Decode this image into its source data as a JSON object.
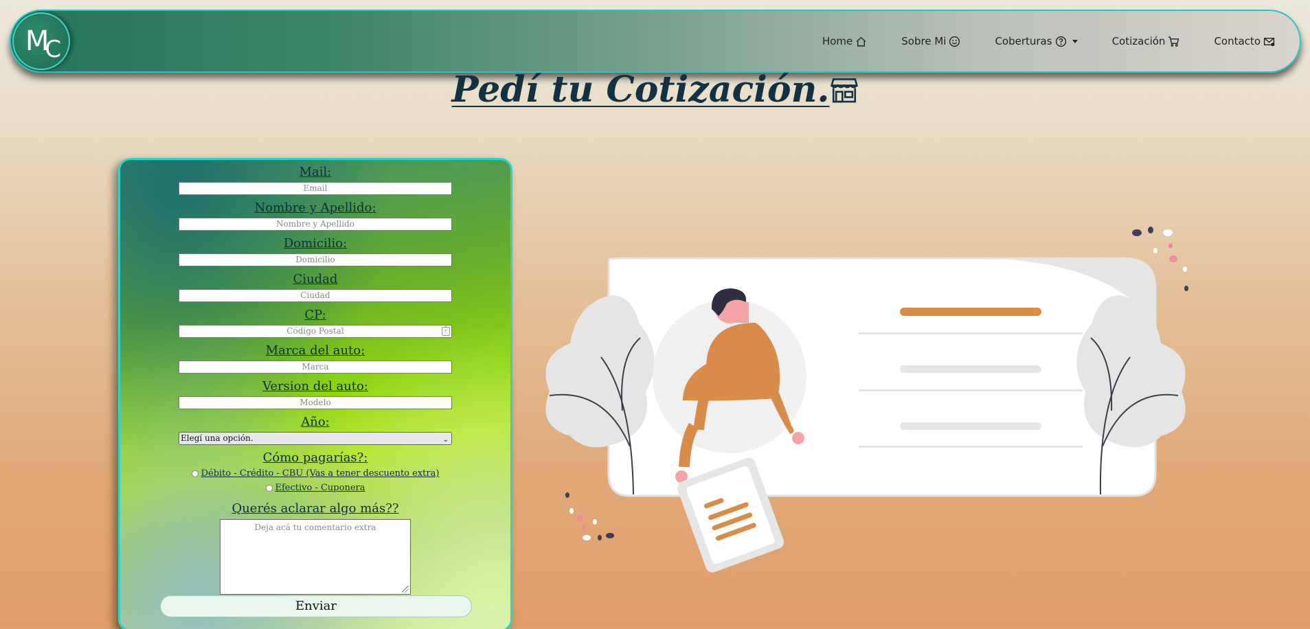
{
  "nav": {
    "logo_text": "MC",
    "items": [
      {
        "label": "Home",
        "icon": "home-icon"
      },
      {
        "label": "Sobre Mi",
        "icon": "smile-icon"
      },
      {
        "label": "Coberturas",
        "icon": "question-circle-icon"
      },
      {
        "label": "Cotización",
        "icon": "cart-icon"
      },
      {
        "label": "Contacto",
        "icon": "envelope-icon"
      }
    ]
  },
  "page": {
    "title": "Pedí tu Cotización.",
    "title_icon": "shop-icon"
  },
  "form": {
    "mail": {
      "label": "Mail:",
      "placeholder": "Email"
    },
    "nombre": {
      "label": "Nombre y Apellido:",
      "placeholder": "Nombre y Apellido"
    },
    "domicilio": {
      "label": "Domicilio:",
      "placeholder": "Domicilio"
    },
    "ciudad": {
      "label": "Ciudad",
      "placeholder": "Ciudad"
    },
    "cp": {
      "label": "CP:",
      "placeholder": "Código Postal"
    },
    "marca": {
      "label": "Marca del auto:",
      "placeholder": "Marca"
    },
    "version": {
      "label": "Version del auto:",
      "placeholder": "Modelo"
    },
    "anio": {
      "label": "Año:",
      "selected": "Elegí una opción."
    },
    "pago": {
      "label": "Cómo pagarías?:",
      "options": [
        "Débito - Crédito - CBU (Vas a tener descuento extra)",
        "Efectivo - Cuponera"
      ]
    },
    "comentario": {
      "label": "Querés aclarar algo más??",
      "placeholder": "Deja acá tu comentario extra"
    },
    "submit_label": "Enviar"
  },
  "colors": {
    "accent_border": "#1fc9c9",
    "title_color": "#123142",
    "illustration_orange": "#d98c4a"
  }
}
